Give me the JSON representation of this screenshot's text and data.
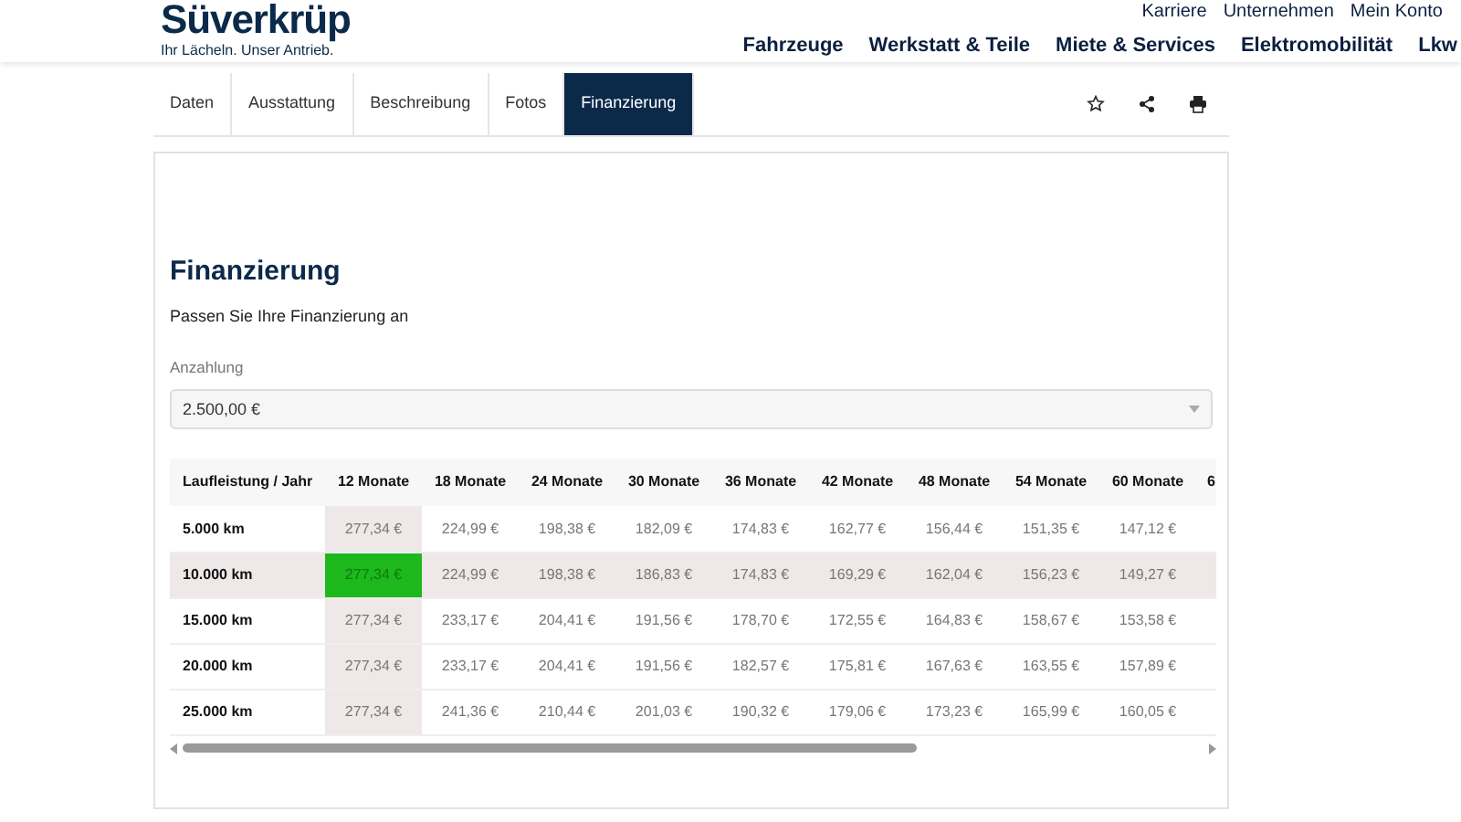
{
  "header": {
    "logo": "Süverkrüp",
    "tagline": "Ihr Lächeln. Unser Antrieb.",
    "top_links": [
      "Karriere",
      "Unternehmen",
      "Mein Konto"
    ],
    "main_nav": [
      "Fahrzeuge",
      "Werkstatt & Teile",
      "Miete & Services",
      "Elektromobilität",
      "Lkw"
    ]
  },
  "tabs": [
    {
      "label": "Daten",
      "selected": false
    },
    {
      "label": "Ausstattung",
      "selected": false
    },
    {
      "label": "Beschreibung",
      "selected": false
    },
    {
      "label": "Fotos",
      "selected": false
    },
    {
      "label": "Finanzierung",
      "selected": true
    }
  ],
  "tab_actions": [
    {
      "kind": "star"
    },
    {
      "kind": "share"
    },
    {
      "kind": "print"
    }
  ],
  "section": {
    "title": "Finanzierung",
    "subtitle": "Passen Sie Ihre Finanzierung an"
  },
  "down_payment": {
    "label": "Anzahlung",
    "value": "2.500,00 €"
  },
  "table": {
    "columns": [
      "Laufleistung / Jahr",
      "12 Monate",
      "18 Monate",
      "24 Monate",
      "30 Monate",
      "36 Monate",
      "42 Monate",
      "48 Monate",
      "54 Monate",
      "60 Monate",
      "6"
    ],
    "rows": [
      {
        "selected": false,
        "cells": [
          {
            "kind": "label",
            "value": "5.000 km"
          },
          {
            "kind": "rate",
            "value": "277,34 €",
            "selected": false
          },
          {
            "kind": "rate",
            "value": "224,99 €",
            "selected": false
          },
          {
            "kind": "rate",
            "value": "198,38 €",
            "selected": false
          },
          {
            "kind": "rate",
            "value": "182,09 €",
            "selected": false
          },
          {
            "kind": "rate",
            "value": "174,83 €",
            "selected": false
          },
          {
            "kind": "rate",
            "value": "162,77 €",
            "selected": false
          },
          {
            "kind": "rate",
            "value": "156,44 €",
            "selected": false
          },
          {
            "kind": "rate",
            "value": "151,35 €",
            "selected": false
          },
          {
            "kind": "rate",
            "value": "147,12 €",
            "selected": false
          }
        ]
      },
      {
        "selected": true,
        "cells": [
          {
            "kind": "label",
            "value": "10.000 km"
          },
          {
            "kind": "rate",
            "value": "277,34 €",
            "selected": true
          },
          {
            "kind": "rate",
            "value": "224,99 €",
            "selected": false
          },
          {
            "kind": "rate",
            "value": "198,38 €",
            "selected": false
          },
          {
            "kind": "rate",
            "value": "186,83 €",
            "selected": false
          },
          {
            "kind": "rate",
            "value": "174,83 €",
            "selected": false
          },
          {
            "kind": "rate",
            "value": "169,29 €",
            "selected": false
          },
          {
            "kind": "rate",
            "value": "162,04 €",
            "selected": false
          },
          {
            "kind": "rate",
            "value": "156,23 €",
            "selected": false
          },
          {
            "kind": "rate",
            "value": "149,27 €",
            "selected": false
          }
        ]
      },
      {
        "selected": false,
        "cells": [
          {
            "kind": "label",
            "value": "15.000 km"
          },
          {
            "kind": "rate",
            "value": "277,34 €",
            "selected": false
          },
          {
            "kind": "rate",
            "value": "233,17 €",
            "selected": false
          },
          {
            "kind": "rate",
            "value": "204,41 €",
            "selected": false
          },
          {
            "kind": "rate",
            "value": "191,56 €",
            "selected": false
          },
          {
            "kind": "rate",
            "value": "178,70 €",
            "selected": false
          },
          {
            "kind": "rate",
            "value": "172,55 €",
            "selected": false
          },
          {
            "kind": "rate",
            "value": "164,83 €",
            "selected": false
          },
          {
            "kind": "rate",
            "value": "158,67 €",
            "selected": false
          },
          {
            "kind": "rate",
            "value": "153,58 €",
            "selected": false
          }
        ]
      },
      {
        "selected": false,
        "cells": [
          {
            "kind": "label",
            "value": "20.000 km"
          },
          {
            "kind": "rate",
            "value": "277,34 €",
            "selected": false
          },
          {
            "kind": "rate",
            "value": "233,17 €",
            "selected": false
          },
          {
            "kind": "rate",
            "value": "204,41 €",
            "selected": false
          },
          {
            "kind": "rate",
            "value": "191,56 €",
            "selected": false
          },
          {
            "kind": "rate",
            "value": "182,57 €",
            "selected": false
          },
          {
            "kind": "rate",
            "value": "175,81 €",
            "selected": false
          },
          {
            "kind": "rate",
            "value": "167,63 €",
            "selected": false
          },
          {
            "kind": "rate",
            "value": "163,55 €",
            "selected": false
          },
          {
            "kind": "rate",
            "value": "157,89 €",
            "selected": false
          }
        ]
      },
      {
        "selected": false,
        "cells": [
          {
            "kind": "label",
            "value": "25.000 km"
          },
          {
            "kind": "rate",
            "value": "277,34 €",
            "selected": false
          },
          {
            "kind": "rate",
            "value": "241,36 €",
            "selected": false
          },
          {
            "kind": "rate",
            "value": "210,44 €",
            "selected": false
          },
          {
            "kind": "rate",
            "value": "201,03 €",
            "selected": false
          },
          {
            "kind": "rate",
            "value": "190,32 €",
            "selected": false
          },
          {
            "kind": "rate",
            "value": "179,06 €",
            "selected": false
          },
          {
            "kind": "rate",
            "value": "173,23 €",
            "selected": false
          },
          {
            "kind": "rate",
            "value": "165,99 €",
            "selected": false
          },
          {
            "kind": "rate",
            "value": "160,05 €",
            "selected": false
          }
        ]
      }
    ]
  }
}
